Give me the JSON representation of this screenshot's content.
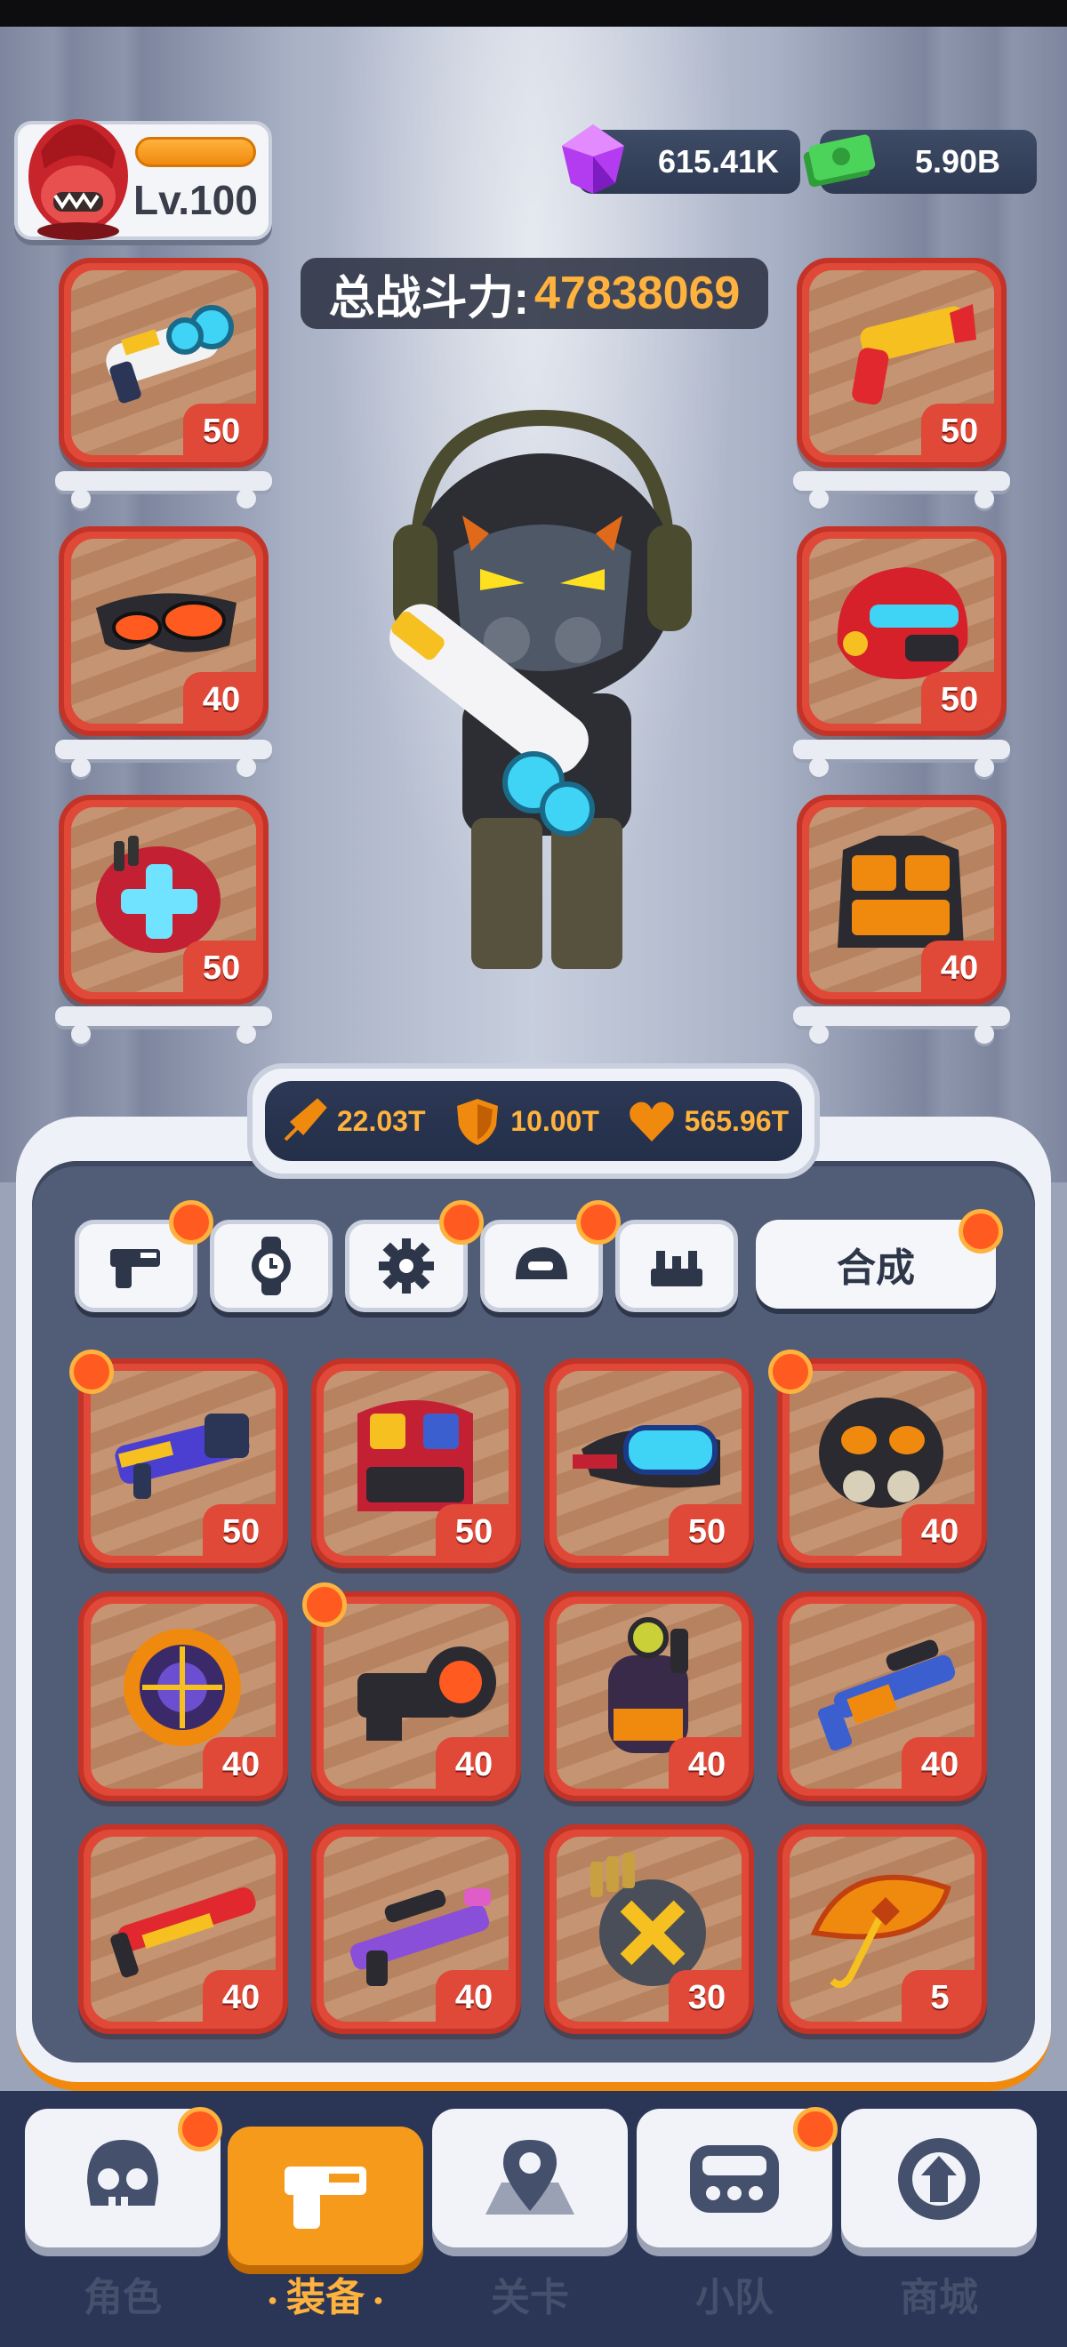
{
  "player": {
    "level": "Lv.100"
  },
  "currencies": {
    "gems": "615.41K",
    "cash": "5.90B"
  },
  "power": {
    "label": "总战斗力:",
    "value": "47838069"
  },
  "equipped_left": [
    {
      "icon": "blaster-gun-icon",
      "level": "50"
    },
    {
      "icon": "goggles-icon",
      "level": "40"
    },
    {
      "icon": "medkit-heart-icon",
      "level": "50"
    }
  ],
  "equipped_right": [
    {
      "icon": "golden-pistol-icon",
      "level": "50"
    },
    {
      "icon": "red-helmet-icon",
      "level": "50"
    },
    {
      "icon": "orange-armor-vest-icon",
      "level": "40"
    }
  ],
  "stats": {
    "attack": "22.03T",
    "defense": "10.00T",
    "health": "565.96T"
  },
  "tabs": {
    "items": [
      "weapon-tab",
      "watch-tab",
      "gear-tab",
      "helmet-tab",
      "armor-tab"
    ],
    "merge_label": "合成"
  },
  "inventory": [
    {
      "icon": "purple-launcher-icon",
      "level": "50",
      "new": true
    },
    {
      "icon": "red-armor-icon",
      "level": "50",
      "new": false
    },
    {
      "icon": "cyan-goggles-icon",
      "level": "50",
      "new": false
    },
    {
      "icon": "gas-mask-icon",
      "level": "40",
      "new": true
    },
    {
      "icon": "purple-shield-icon",
      "level": "40",
      "new": false
    },
    {
      "icon": "scope-icon",
      "level": "40",
      "new": true
    },
    {
      "icon": "grenade-icon",
      "level": "40",
      "new": false
    },
    {
      "icon": "blue-rifle-icon",
      "level": "40",
      "new": false
    },
    {
      "icon": "red-shotgun-icon",
      "level": "40",
      "new": false
    },
    {
      "icon": "purple-sniper-icon",
      "level": "40",
      "new": false
    },
    {
      "icon": "ammo-drum-icon",
      "level": "30",
      "new": false
    },
    {
      "icon": "orange-umbrella-icon",
      "level": "5",
      "new": false
    }
  ],
  "nav": {
    "character": "角色",
    "equipment": "装备",
    "stage": "关卡",
    "squad": "小队",
    "shop": "商城"
  },
  "colors": {
    "accent": "#f59a1a",
    "slot_red": "#e04838",
    "panel": "#515c77"
  }
}
